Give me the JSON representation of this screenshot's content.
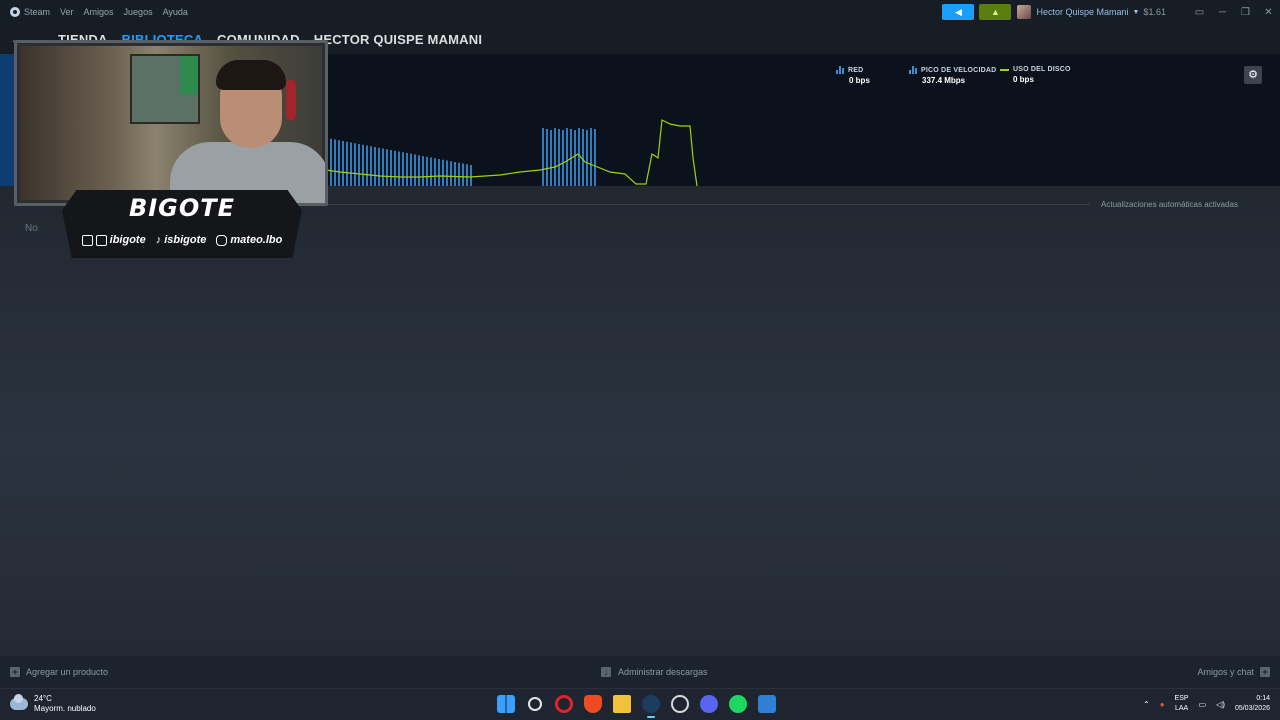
{
  "menu": {
    "app": "Steam",
    "items": [
      "Ver",
      "Amigos",
      "Juegos",
      "Ayuda"
    ]
  },
  "account": {
    "name": "Hector Quispe Mamani",
    "balance": "$1.61"
  },
  "nav": {
    "tabs": [
      {
        "label": "TIENDA",
        "active": false
      },
      {
        "label": "BIBLIOTECA",
        "active": true
      },
      {
        "label": "COMUNIDAD",
        "active": false
      },
      {
        "label": "HECTOR QUISPE MAMANI",
        "active": false
      }
    ]
  },
  "downloads": {
    "legend": [
      {
        "label": "RED",
        "value": "0 bps",
        "icon": "bars"
      },
      {
        "label": "PICO DE VELOCIDAD",
        "value": "337.4 Mbps",
        "icon": "bars"
      },
      {
        "label": "USO DEL DISCO",
        "value": "0 bps",
        "icon": "line"
      }
    ],
    "auto_updates": "Actualizaciones automáticas activadas",
    "empty_prefix": "No"
  },
  "bottom_bar": {
    "add_product": "Agregar un producto",
    "manage_downloads": "Administrar descargas",
    "friends_chat": "Amigos y chat"
  },
  "taskbar": {
    "temp": "24°C",
    "weather": "Mayorm. nublado",
    "lang_top": "ESP",
    "lang_bottom": "LAA",
    "time": "0:14",
    "date": "05/03/2026",
    "apps": [
      "start-icon",
      "search-icon",
      "opera-icon",
      "brave-icon",
      "folder-icon",
      "steam-icon",
      "obs-icon",
      "discord-icon",
      "spotify-icon",
      "editor-icon"
    ]
  },
  "overlay": {
    "brand": "BIGOTE",
    "socials": [
      "ibigote",
      "isbigote",
      "mateo.lbo"
    ]
  },
  "colors": {
    "accent": "#1a9fff",
    "network_bars": "#3b8fd8",
    "disk_line": "#a4d007"
  }
}
